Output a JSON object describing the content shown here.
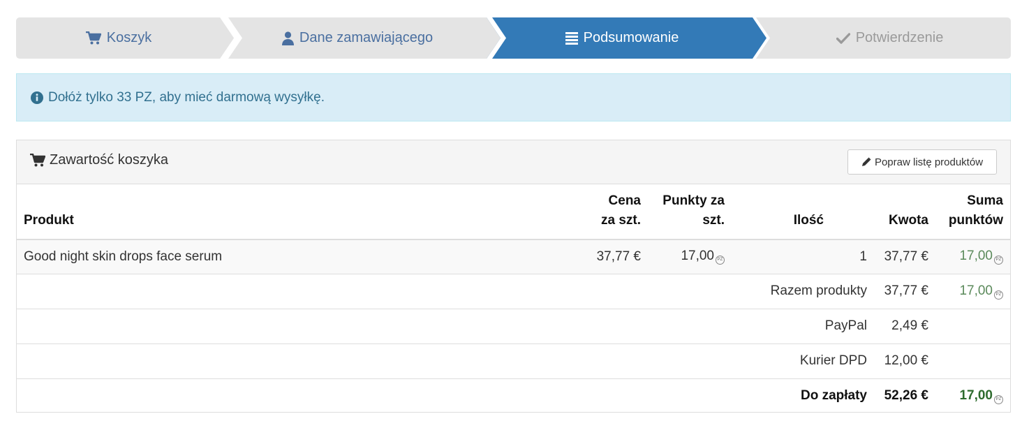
{
  "steps": [
    {
      "label": "Koszyk",
      "icon": "cart-icon"
    },
    {
      "label": "Dane zamawiającego",
      "icon": "user-icon"
    },
    {
      "label": "Podsumowanie",
      "icon": "list-icon",
      "active": true
    },
    {
      "label": "Potwierdzenie",
      "icon": "check-icon"
    }
  ],
  "alert": {
    "text": "Dołóż tylko 33 PZ, aby mieć darmową wysyłkę.",
    "icon": "info-icon"
  },
  "panel": {
    "title": "Zawartość koszyka",
    "edit_button": "Popraw listę produktów"
  },
  "table": {
    "headers": {
      "product": "Produkt",
      "price_l1": "Cena",
      "price_l2": "za szt.",
      "points_l1": "Punkty za",
      "points_l2": "szt.",
      "qty": "Ilość",
      "amount": "Kwota",
      "sum_points_l1": "Suma",
      "sum_points_l2": "punktów"
    },
    "items": [
      {
        "name": "Good night skin drops face serum",
        "price": "37,77 €",
        "points": "17,00",
        "qty": "1",
        "amount": "37,77 €",
        "sum_points": "17,00"
      }
    ],
    "subtotal": {
      "label": "Razem produkty",
      "amount": "37,77 €",
      "points": "17,00"
    },
    "payment": {
      "label": "PayPal",
      "amount": "2,49 €"
    },
    "shipping": {
      "label": "Kurier DPD",
      "amount": "12,00 €"
    },
    "total": {
      "label": "Do zapłaty",
      "amount": "52,26 €",
      "points": "17,00"
    },
    "points_unit": "PZ"
  },
  "colors": {
    "active_step": "#337ab7",
    "alert_bg": "#d9edf7",
    "alert_text": "#31708f",
    "points": "#5b8a5b"
  }
}
